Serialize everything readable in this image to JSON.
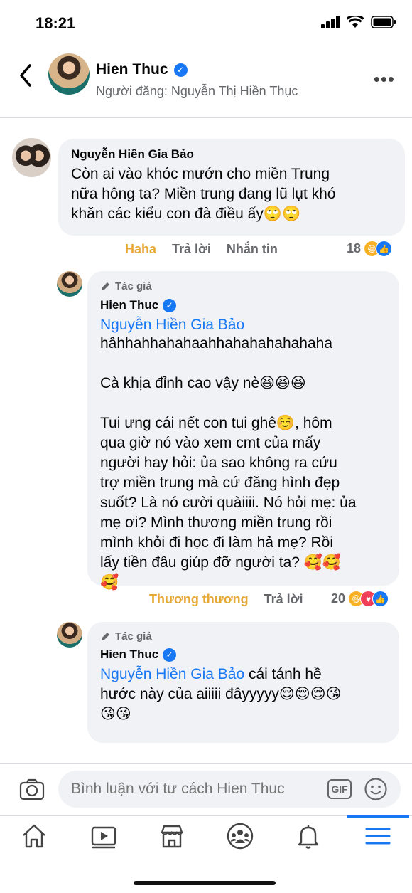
{
  "status": {
    "time": "18:21"
  },
  "header": {
    "name": "Hien Thuc",
    "subtitle": "Người đăng: Nguyễn Thị Hiền Thục",
    "verified_icon": "check-badge-icon"
  },
  "comments": [
    {
      "name": "Nguyễn Hiền Gia Bảo",
      "text": "Còn ai vào khóc mướn cho miền Trung\nnữa hông ta? Miền trung đang lũ lụt khó\nkhăn các kiểu con đà điều ấy🙄🙄",
      "actions": [
        "Haha",
        "Trả lời",
        "Nhắn tin"
      ],
      "count": "18"
    },
    {
      "author_label": "Tác giả",
      "name": "Hien Thuc",
      "mention": "Nguyễn Hiền Gia Bảo",
      "text": "hâhhahhahahaahhahahahahahaha\n\nCà khịa đỉnh cao vậy nè😆😆😆\n\nTui ưng cái nết con tui ghê☺️, hôm\nqua giờ nó vào xem cmt của mấy\nngười hay hỏi: ủa sao không ra cứu\ntrợ miền trung mà cứ đăng hình đẹp\nsuốt? Là nó cười quàiiii. Nó hỏi mẹ: ủa\nmẹ ơi? Mình thương miền trung rồi\nmình khỏi đi học đi làm hả mẹ? Rồi\nlấy tiền đâu giúp đỡ người ta? 🥰🥰\n🥰",
      "actions": [
        "Thương thương",
        "Trả lời"
      ],
      "count": "20"
    },
    {
      "author_label": "Tác giả",
      "name": "Hien Thuc",
      "mention": "Nguyễn Hiền Gia Bảo",
      "text_after_mention": "  cái tánh hề\nhước này của aiiiii đâyyyyy😌😌😌😘\n😘😘"
    }
  ],
  "composer": {
    "placeholder": "Bình luận với tư cách Hien Thuc",
    "gif_label": "GIF"
  },
  "nav": [
    "home-icon",
    "video-icon",
    "marketplace-icon",
    "groups-icon",
    "notifications-icon",
    "menu-icon"
  ],
  "colors": {
    "accent": "#1877f2",
    "haha": "#e7a935",
    "bubble": "#f0f2f5"
  }
}
